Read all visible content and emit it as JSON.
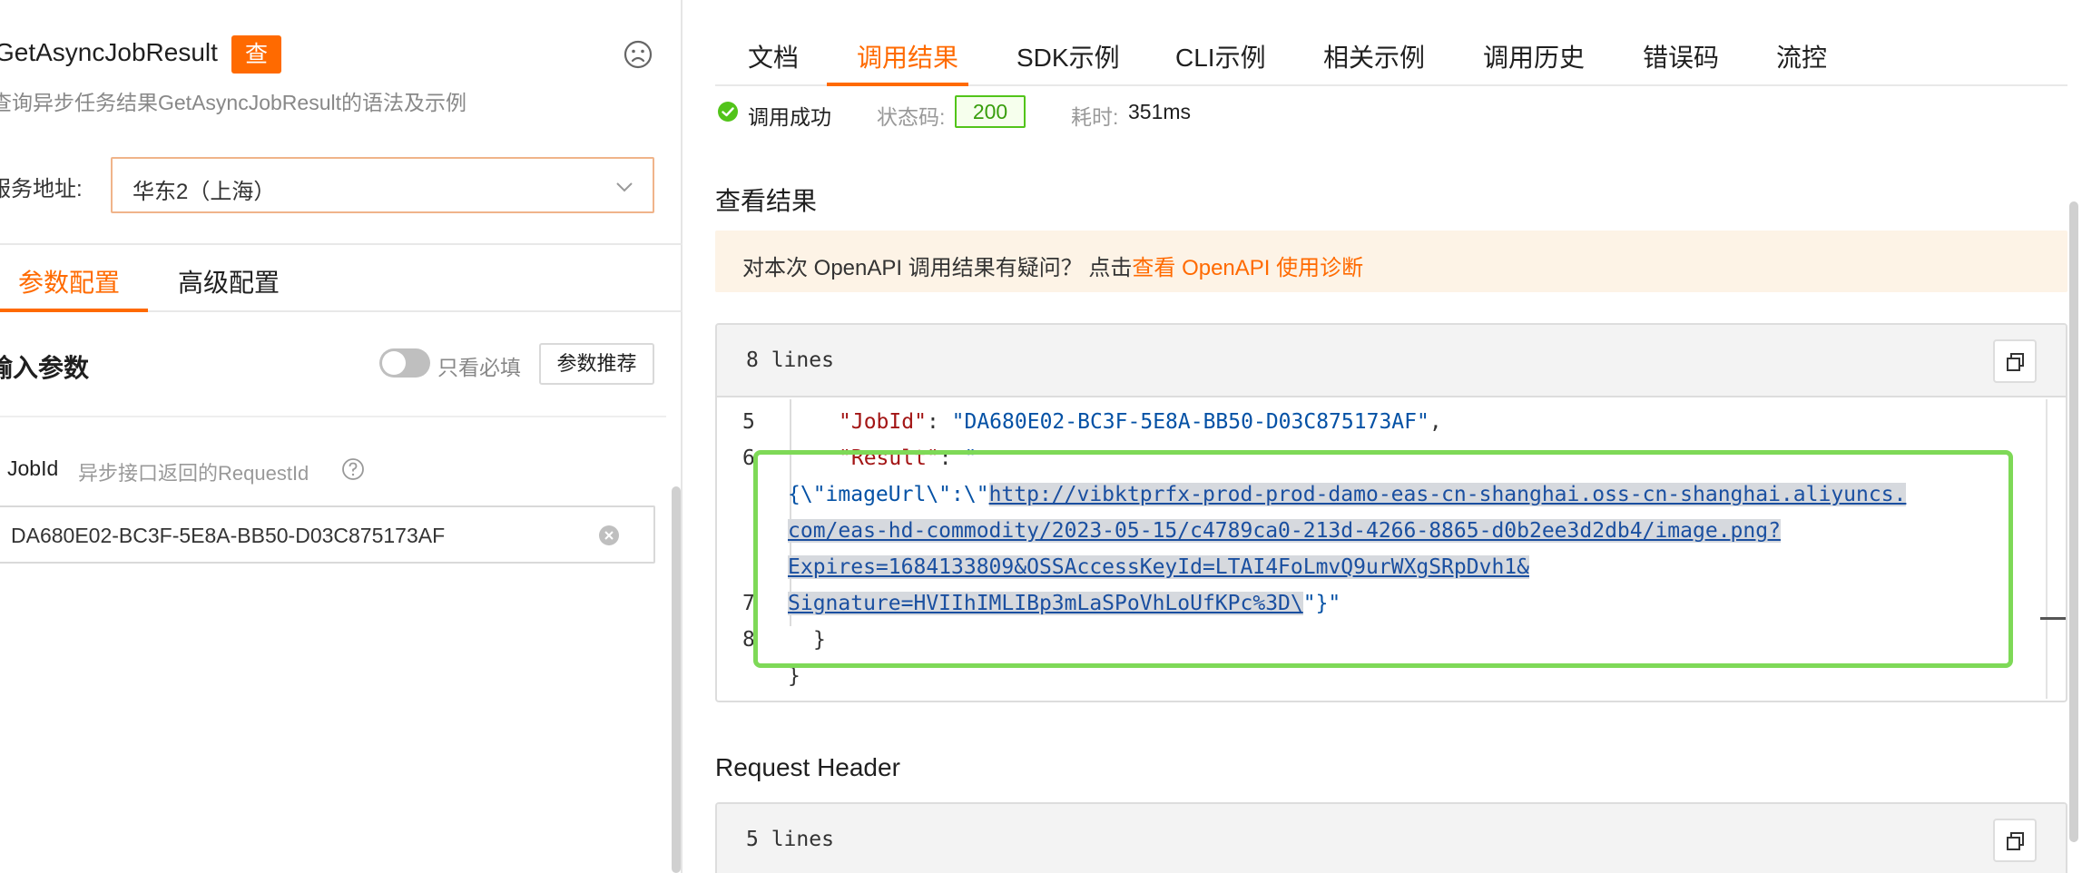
{
  "left_panel": {
    "api_name": "GetAsyncJobResult",
    "api_badge": "查",
    "api_description": "查询异步任务结果GetAsyncJobResult的语法及示例",
    "service_address_label": "服务地址:",
    "service_address_value": "华东2（上海）",
    "tabs": [
      {
        "label": "参数配置",
        "active": true
      },
      {
        "label": "高级配置",
        "active": false
      }
    ],
    "input_params_title": "输入参数",
    "required_only_toggle": {
      "label": "只看必填",
      "on": false
    },
    "recommend_button": "参数推荐",
    "param": {
      "name": "JobId",
      "hint": "异步接口返回的RequestId",
      "value": "DA680E02-BC3F-5E8A-BB50-D03C875173AF"
    }
  },
  "right_panel": {
    "tabs": [
      {
        "label": "文档",
        "active": false
      },
      {
        "label": "调用结果",
        "active": true
      },
      {
        "label": "SDK示例",
        "active": false
      },
      {
        "label": "CLI示例",
        "active": false
      },
      {
        "label": "相关示例",
        "active": false
      },
      {
        "label": "调用历史",
        "active": false
      },
      {
        "label": "错误码",
        "active": false
      },
      {
        "label": "流控",
        "active": false
      }
    ],
    "status": {
      "text": "调用成功",
      "code_label": "状态码:",
      "code_value": "200",
      "elapsed_label": "耗时:",
      "elapsed_value": "351ms"
    },
    "result_title": "查看结果",
    "notice": {
      "text": "对本次 OpenAPI 调用结果有疑问？ 点击",
      "link": "查看 OpenAPI 使用诊断"
    },
    "result_code": {
      "lines_label": "8 lines",
      "line_numbers": [
        "5",
        "6",
        "7",
        "8"
      ],
      "line5_key": "\"JobId\"",
      "line5_colon": ": ",
      "line5_value": "\"DA680E02-BC3F-5E8A-BB50-D03C875173AF\"",
      "line5_comma": ",",
      "line6_key": "\"Result\"",
      "line6_colon": ": ",
      "line6_value": "\"",
      "wrap_prefix": "{\\\"imageUrl\\\":\\\"",
      "url_part1": "http://vibktprfx-prod-prod-damo-eas-cn-shanghai.oss-cn-shanghai.aliyuncs.",
      "url_part2": "com/eas-hd-commodity/2023-05-15/c4789ca0-213d-4266-8865-d0b2ee3d2db4/image.png?",
      "url_part3": "Expires=1684133809&OSSAccessKeyId=LTAI4FoLmvQ9urWXgSRpDvh1&",
      "url_part4": "Signature=HVIIhIMLIBp3mLaSPoVhLoUfKPc%3D\\",
      "wrap_suffix": "\"}\"",
      "line7": "}",
      "line8": "}"
    },
    "request_header_title": "Request Header",
    "request_header_code": {
      "lines_label": "5 lines"
    }
  },
  "colors": {
    "accent": "#ff6a00",
    "success": "#52c41a",
    "highlight_box": "#7ed957",
    "notice_bg": "#fdf3e6"
  },
  "icons": {
    "feedback": "sad-face-icon",
    "select": "chevron-down-icon",
    "help": "question-circle-icon",
    "clear": "clear-circle-icon",
    "status": "check-circle-icon",
    "copy": "copy-icon"
  }
}
